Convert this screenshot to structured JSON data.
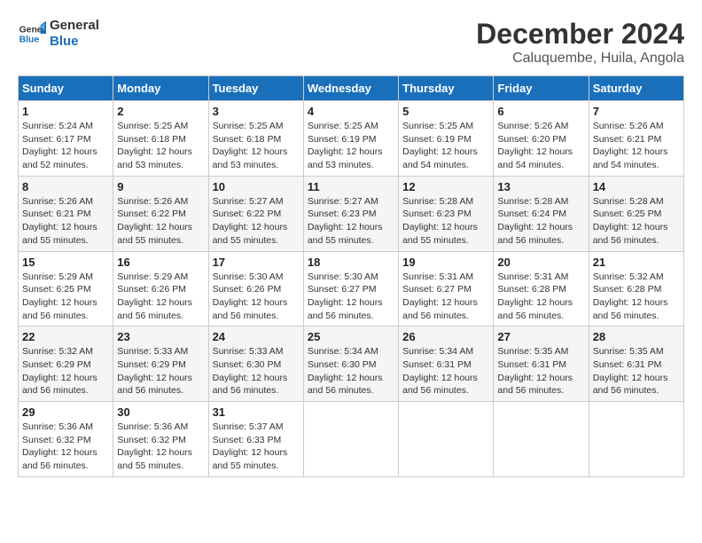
{
  "logo": {
    "line1": "General",
    "line2": "Blue"
  },
  "title": "December 2024",
  "location": "Caluquembe, Huila, Angola",
  "weekdays": [
    "Sunday",
    "Monday",
    "Tuesday",
    "Wednesday",
    "Thursday",
    "Friday",
    "Saturday"
  ],
  "weeks": [
    [
      {
        "day": "1",
        "sunrise": "5:24 AM",
        "sunset": "6:17 PM",
        "daylight": "12 hours and 52 minutes."
      },
      {
        "day": "2",
        "sunrise": "5:25 AM",
        "sunset": "6:18 PM",
        "daylight": "12 hours and 53 minutes."
      },
      {
        "day": "3",
        "sunrise": "5:25 AM",
        "sunset": "6:18 PM",
        "daylight": "12 hours and 53 minutes."
      },
      {
        "day": "4",
        "sunrise": "5:25 AM",
        "sunset": "6:19 PM",
        "daylight": "12 hours and 53 minutes."
      },
      {
        "day": "5",
        "sunrise": "5:25 AM",
        "sunset": "6:19 PM",
        "daylight": "12 hours and 54 minutes."
      },
      {
        "day": "6",
        "sunrise": "5:26 AM",
        "sunset": "6:20 PM",
        "daylight": "12 hours and 54 minutes."
      },
      {
        "day": "7",
        "sunrise": "5:26 AM",
        "sunset": "6:21 PM",
        "daylight": "12 hours and 54 minutes."
      }
    ],
    [
      {
        "day": "8",
        "sunrise": "5:26 AM",
        "sunset": "6:21 PM",
        "daylight": "12 hours and 55 minutes."
      },
      {
        "day": "9",
        "sunrise": "5:26 AM",
        "sunset": "6:22 PM",
        "daylight": "12 hours and 55 minutes."
      },
      {
        "day": "10",
        "sunrise": "5:27 AM",
        "sunset": "6:22 PM",
        "daylight": "12 hours and 55 minutes."
      },
      {
        "day": "11",
        "sunrise": "5:27 AM",
        "sunset": "6:23 PM",
        "daylight": "12 hours and 55 minutes."
      },
      {
        "day": "12",
        "sunrise": "5:28 AM",
        "sunset": "6:23 PM",
        "daylight": "12 hours and 55 minutes."
      },
      {
        "day": "13",
        "sunrise": "5:28 AM",
        "sunset": "6:24 PM",
        "daylight": "12 hours and 56 minutes."
      },
      {
        "day": "14",
        "sunrise": "5:28 AM",
        "sunset": "6:25 PM",
        "daylight": "12 hours and 56 minutes."
      }
    ],
    [
      {
        "day": "15",
        "sunrise": "5:29 AM",
        "sunset": "6:25 PM",
        "daylight": "12 hours and 56 minutes."
      },
      {
        "day": "16",
        "sunrise": "5:29 AM",
        "sunset": "6:26 PM",
        "daylight": "12 hours and 56 minutes."
      },
      {
        "day": "17",
        "sunrise": "5:30 AM",
        "sunset": "6:26 PM",
        "daylight": "12 hours and 56 minutes."
      },
      {
        "day": "18",
        "sunrise": "5:30 AM",
        "sunset": "6:27 PM",
        "daylight": "12 hours and 56 minutes."
      },
      {
        "day": "19",
        "sunrise": "5:31 AM",
        "sunset": "6:27 PM",
        "daylight": "12 hours and 56 minutes."
      },
      {
        "day": "20",
        "sunrise": "5:31 AM",
        "sunset": "6:28 PM",
        "daylight": "12 hours and 56 minutes."
      },
      {
        "day": "21",
        "sunrise": "5:32 AM",
        "sunset": "6:28 PM",
        "daylight": "12 hours and 56 minutes."
      }
    ],
    [
      {
        "day": "22",
        "sunrise": "5:32 AM",
        "sunset": "6:29 PM",
        "daylight": "12 hours and 56 minutes."
      },
      {
        "day": "23",
        "sunrise": "5:33 AM",
        "sunset": "6:29 PM",
        "daylight": "12 hours and 56 minutes."
      },
      {
        "day": "24",
        "sunrise": "5:33 AM",
        "sunset": "6:30 PM",
        "daylight": "12 hours and 56 minutes."
      },
      {
        "day": "25",
        "sunrise": "5:34 AM",
        "sunset": "6:30 PM",
        "daylight": "12 hours and 56 minutes."
      },
      {
        "day": "26",
        "sunrise": "5:34 AM",
        "sunset": "6:31 PM",
        "daylight": "12 hours and 56 minutes."
      },
      {
        "day": "27",
        "sunrise": "5:35 AM",
        "sunset": "6:31 PM",
        "daylight": "12 hours and 56 minutes."
      },
      {
        "day": "28",
        "sunrise": "5:35 AM",
        "sunset": "6:31 PM",
        "daylight": "12 hours and 56 minutes."
      }
    ],
    [
      {
        "day": "29",
        "sunrise": "5:36 AM",
        "sunset": "6:32 PM",
        "daylight": "12 hours and 56 minutes."
      },
      {
        "day": "30",
        "sunrise": "5:36 AM",
        "sunset": "6:32 PM",
        "daylight": "12 hours and 55 minutes."
      },
      {
        "day": "31",
        "sunrise": "5:37 AM",
        "sunset": "6:33 PM",
        "daylight": "12 hours and 55 minutes."
      },
      null,
      null,
      null,
      null
    ]
  ]
}
